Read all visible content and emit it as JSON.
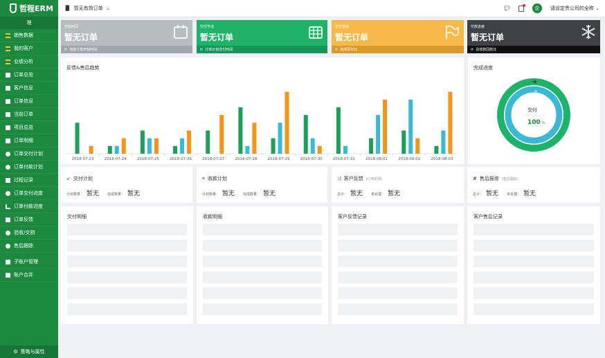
{
  "app": {
    "name": "哲程ERM"
  },
  "sidebar": {
    "top_label": "理",
    "items": [
      {
        "label": "销售数据",
        "icon": "list-icon"
      },
      {
        "label": "我的客户",
        "icon": "list-icon"
      },
      {
        "label": "业绩分析",
        "icon": "list-icon"
      },
      {
        "label": "订单总览",
        "icon": "doc-icon"
      },
      {
        "label": "客户信息",
        "icon": "doc-icon"
      },
      {
        "label": "订单信息",
        "icon": "doc-icon"
      },
      {
        "label": "当前订单",
        "icon": "doc-icon"
      },
      {
        "label": "项目总览",
        "icon": "doc-icon"
      },
      {
        "label": "订单明细",
        "icon": "doc-icon"
      },
      {
        "label": "订单交付计划",
        "icon": "circle-icon"
      },
      {
        "label": "订单付款计划",
        "icon": "circle-icon"
      },
      {
        "label": "过程记录",
        "icon": "doc-icon"
      },
      {
        "label": "订单交付进度",
        "icon": "circle-icon"
      },
      {
        "label": "订单付款进度",
        "icon": "chart-icon"
      },
      {
        "label": "订单反馈",
        "icon": "doc-icon"
      },
      {
        "label": "验收/交割",
        "icon": "circle-icon"
      },
      {
        "label": "售后跟踪",
        "icon": "circle-icon"
      },
      {
        "label": "子账户管理",
        "icon": "doc-icon"
      },
      {
        "label": "账户合并",
        "icon": "doc-icon"
      }
    ],
    "footer_label": "策略与属性"
  },
  "topbar": {
    "filter_label": "暂无有效订单",
    "avatar_text": "企",
    "company_label": "请设定贵公司的全称"
  },
  "cards": [
    {
      "label": "开始时间",
      "value": "暂无订单",
      "foot": "当前订单开始时间",
      "color": "#b7bcbf",
      "foot_color": "#a0a6a9",
      "icon": "calendar-icon"
    },
    {
      "label": "交付节点",
      "value": "暂无订单",
      "foot": "订单计划交付时间",
      "color": "#1fb36a",
      "foot_color": "#17955a",
      "icon": "calendar-grid-icon"
    },
    {
      "label": "交付进度",
      "value": "暂无订单",
      "foot": "完成百分比",
      "color": "#f6b94a",
      "foot_color": "#d99a2c",
      "icon": "flag-icon"
    },
    {
      "label": "付款进度",
      "value": "暂无订单",
      "foot": "总收款回款比",
      "color": "#3f4244",
      "foot_color": "#111",
      "icon": "snowflake-icon"
    }
  ],
  "trend": {
    "title": "反馈&售后趋势"
  },
  "chart_data": {
    "type": "bar",
    "categories": [
      "2018-07-23",
      "2018-07-24",
      "2018-07-25",
      "2018-07-26",
      "2018-07-27",
      "2018-07-28",
      "2018-07-29",
      "2018-07-30",
      "2018-07-31",
      "2018-08-01",
      "2018-08-02",
      "2018-08-03"
    ],
    "series": [
      {
        "color": "#1f9e5a",
        "values": [
          4,
          1,
          3,
          1,
          3,
          6,
          2,
          5,
          6,
          2,
          3,
          1
        ]
      },
      {
        "color": "#3bb8d4",
        "values": [
          0,
          1,
          2,
          2,
          0,
          1,
          4,
          2,
          1,
          5,
          7,
          3
        ]
      },
      {
        "color": "#f2951a",
        "values": [
          1,
          2,
          2,
          3,
          5,
          4,
          8,
          1,
          0,
          7,
          2,
          8
        ]
      }
    ],
    "ylim": [
      0,
      8.5
    ],
    "grid": false,
    "legend": "none"
  },
  "progress": {
    "title": "完成进度",
    "center_label": "交付",
    "center_value": "100",
    "unit": "%",
    "ring_outer": "#1fb36a",
    "ring_inner": "#3bb8d4",
    "value": 1.0
  },
  "sections": [
    {
      "title": "交付计划",
      "icon": "send-icon",
      "sub": "",
      "l1": "计划数量：",
      "v1": "暂无",
      "l2": "完成数量：",
      "v2": "暂无"
    },
    {
      "title": "收款计划",
      "icon": "crop-icon",
      "sub": "",
      "l1": "计划数量：",
      "v1": "暂无",
      "l2": "完成数量：",
      "v2": "暂无"
    },
    {
      "title": "客户反馈",
      "icon": "shuffle-icon",
      "sub": "(订单反馈)",
      "l1": "总计：",
      "v1": "暂无",
      "l2": "未处理：",
      "v2": "暂无"
    },
    {
      "title": "售后报修",
      "icon": "hash-icon",
      "sub": "(售后跟踪)",
      "l1": "总计：",
      "v1": "暂无",
      "l2": "未处理：",
      "v2": "暂无"
    }
  ],
  "records": [
    {
      "title": "交付明细"
    },
    {
      "title": "收款明细"
    },
    {
      "title": "客户反馈记录"
    },
    {
      "title": "客户售后记录"
    }
  ]
}
